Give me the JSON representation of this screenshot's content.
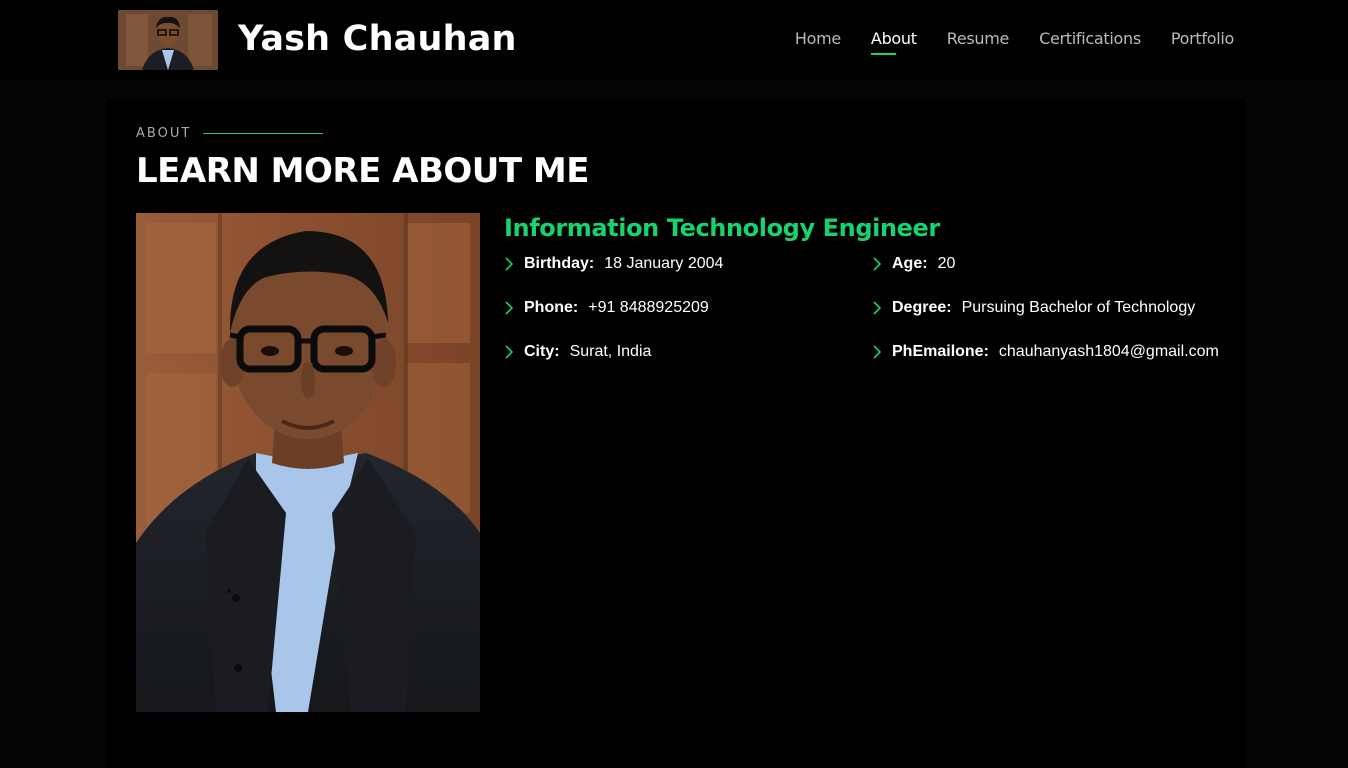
{
  "header": {
    "title": "Yash Chauhan",
    "nav": [
      "Home",
      "About",
      "Resume",
      "Certifications",
      "Portfolio"
    ],
    "active_nav": "About"
  },
  "about": {
    "label": "ABOUT",
    "heading": "LEARN MORE ABOUT ME",
    "role": "Information Technology Engineer",
    "left_details": [
      {
        "key": "Birthday:",
        "value": "18 January 2004"
      },
      {
        "key": "Phone:",
        "value": "+91 8488925209"
      },
      {
        "key": "City:",
        "value": "Surat, India"
      }
    ],
    "right_details": [
      {
        "key": "Age:",
        "value": "20"
      },
      {
        "key": "Degree:",
        "value": "Pursuing Bachelor of Technology"
      },
      {
        "key": "PhEmailone:",
        "value": "chauhanyash1804@gmail.com"
      }
    ]
  },
  "colors": {
    "accent": "#18d26e",
    "background": "#040404",
    "panel": "#000000"
  },
  "icons": [
    "profile-avatar",
    "chevron-right-icon",
    "profile-photo"
  ]
}
